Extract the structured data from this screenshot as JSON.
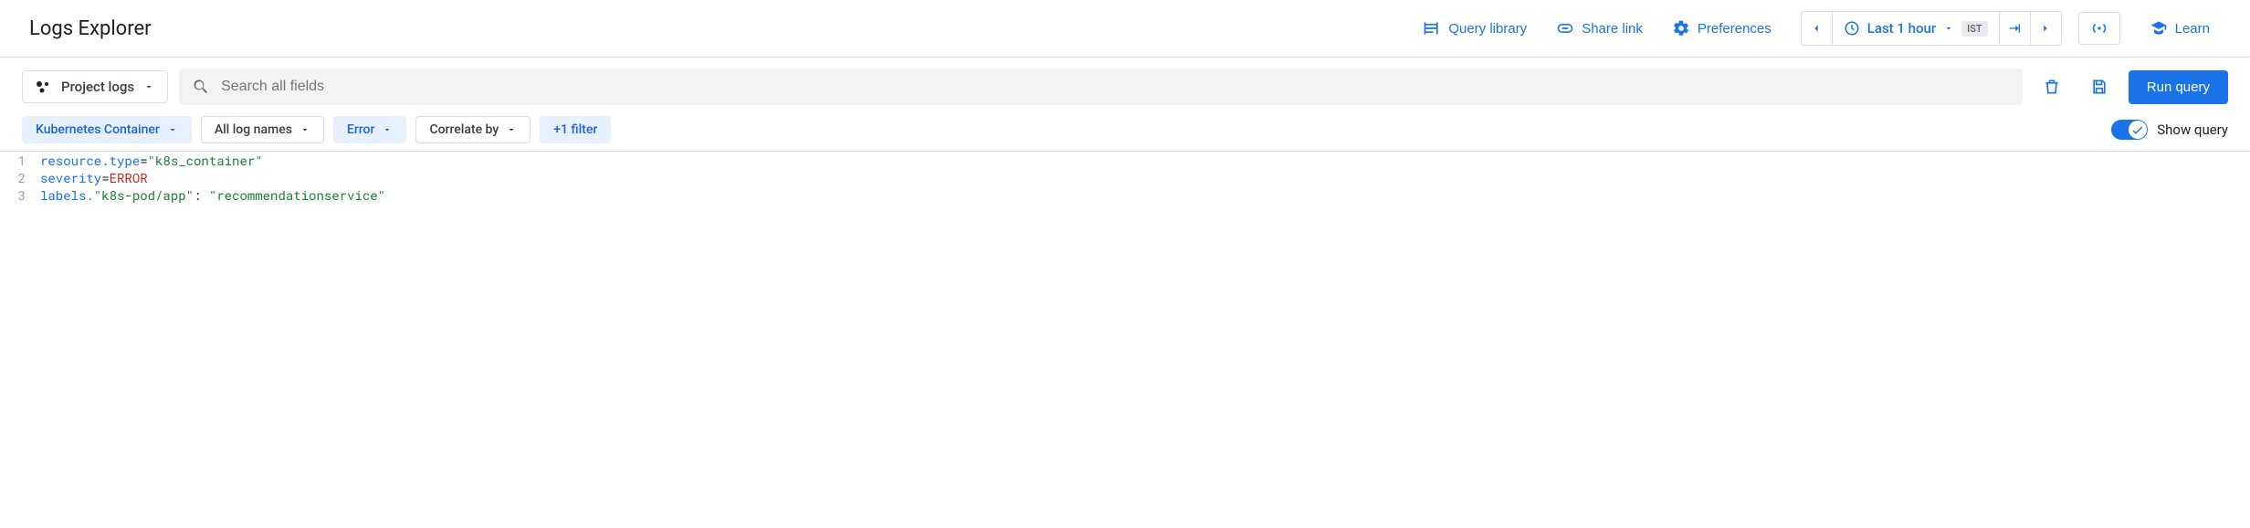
{
  "header": {
    "title": "Logs Explorer",
    "query_library_label": "Query library",
    "share_link_label": "Share link",
    "preferences_label": "Preferences",
    "learn_label": "Learn",
    "time_range_label": "Last 1 hour",
    "timezone_badge": "IST"
  },
  "toolbar": {
    "scope_label": "Project logs",
    "search_placeholder": "Search all fields",
    "run_label": "Run query"
  },
  "filters": {
    "resource_label": "Kubernetes Container",
    "log_names_label": "All log names",
    "severity_label": "Error",
    "correlate_label": "Correlate by",
    "add_filter_label": "+1 filter",
    "show_query_label": "Show query",
    "show_query_on": true
  },
  "query_lines": [
    {
      "n": "1",
      "tokens": [
        {
          "t": "resource.type",
          "c": "tok-key"
        },
        {
          "t": "=",
          "c": "tok-op"
        },
        {
          "t": "\"k8s_container\"",
          "c": "tok-str"
        }
      ]
    },
    {
      "n": "2",
      "tokens": [
        {
          "t": "severity",
          "c": "tok-key"
        },
        {
          "t": "=",
          "c": "tok-op"
        },
        {
          "t": "ERROR",
          "c": "tok-const"
        }
      ]
    },
    {
      "n": "3",
      "tokens": [
        {
          "t": "labels.",
          "c": "tok-key"
        },
        {
          "t": "\"k8s-pod/app\"",
          "c": "tok-str"
        },
        {
          "t": ": ",
          "c": "tok-op"
        },
        {
          "t": "\"recommendationservice\"",
          "c": "tok-str"
        }
      ]
    }
  ]
}
